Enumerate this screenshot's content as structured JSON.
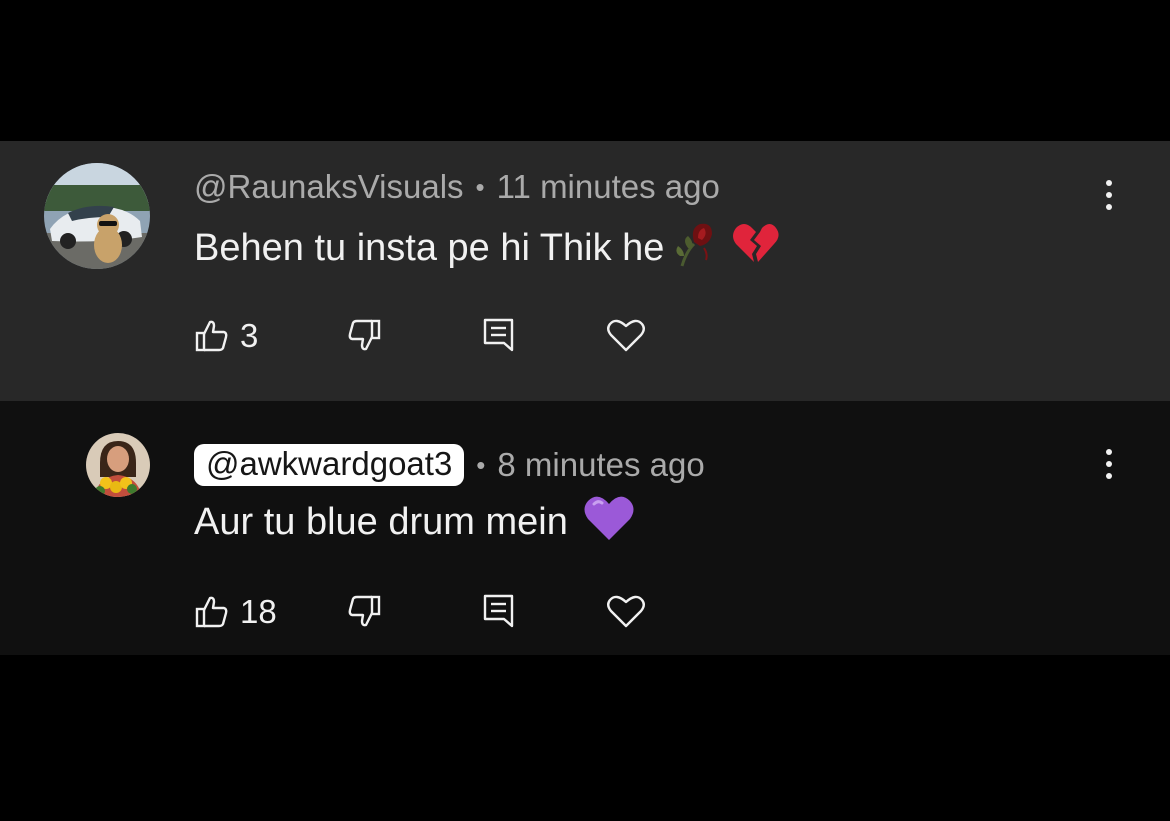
{
  "comments": [
    {
      "author": "@RaunaksVisuals",
      "separator": "•",
      "time": "11 minutes ago",
      "text": "Behen tu insta pe hi Thik he",
      "emojis": [
        "wilted-rose-emoji",
        "broken-heart-emoji"
      ],
      "likes": "3",
      "avatar": "car-and-cat-photo",
      "highlighted_author": false
    },
    {
      "author": "@awkwardgoat3",
      "separator": "•",
      "time": "8 minutes ago",
      "text": "Aur tu blue drum mein",
      "emojis": [
        "purple-heart-emoji"
      ],
      "likes": "18",
      "avatar": "person-with-flowers-photo",
      "highlighted_author": true
    }
  ],
  "icons": [
    "thumbs-up-icon",
    "thumbs-down-icon",
    "reply-icon",
    "heart-icon",
    "more-options-icon"
  ],
  "colors": {
    "comment_1_bg": "#282828",
    "comment_2_bg": "#101010",
    "meta_text": "#aaaaaa",
    "body_text": "#f1f1f1",
    "purple_heart": "#9b59d8",
    "broken_heart": "#e0243b"
  }
}
